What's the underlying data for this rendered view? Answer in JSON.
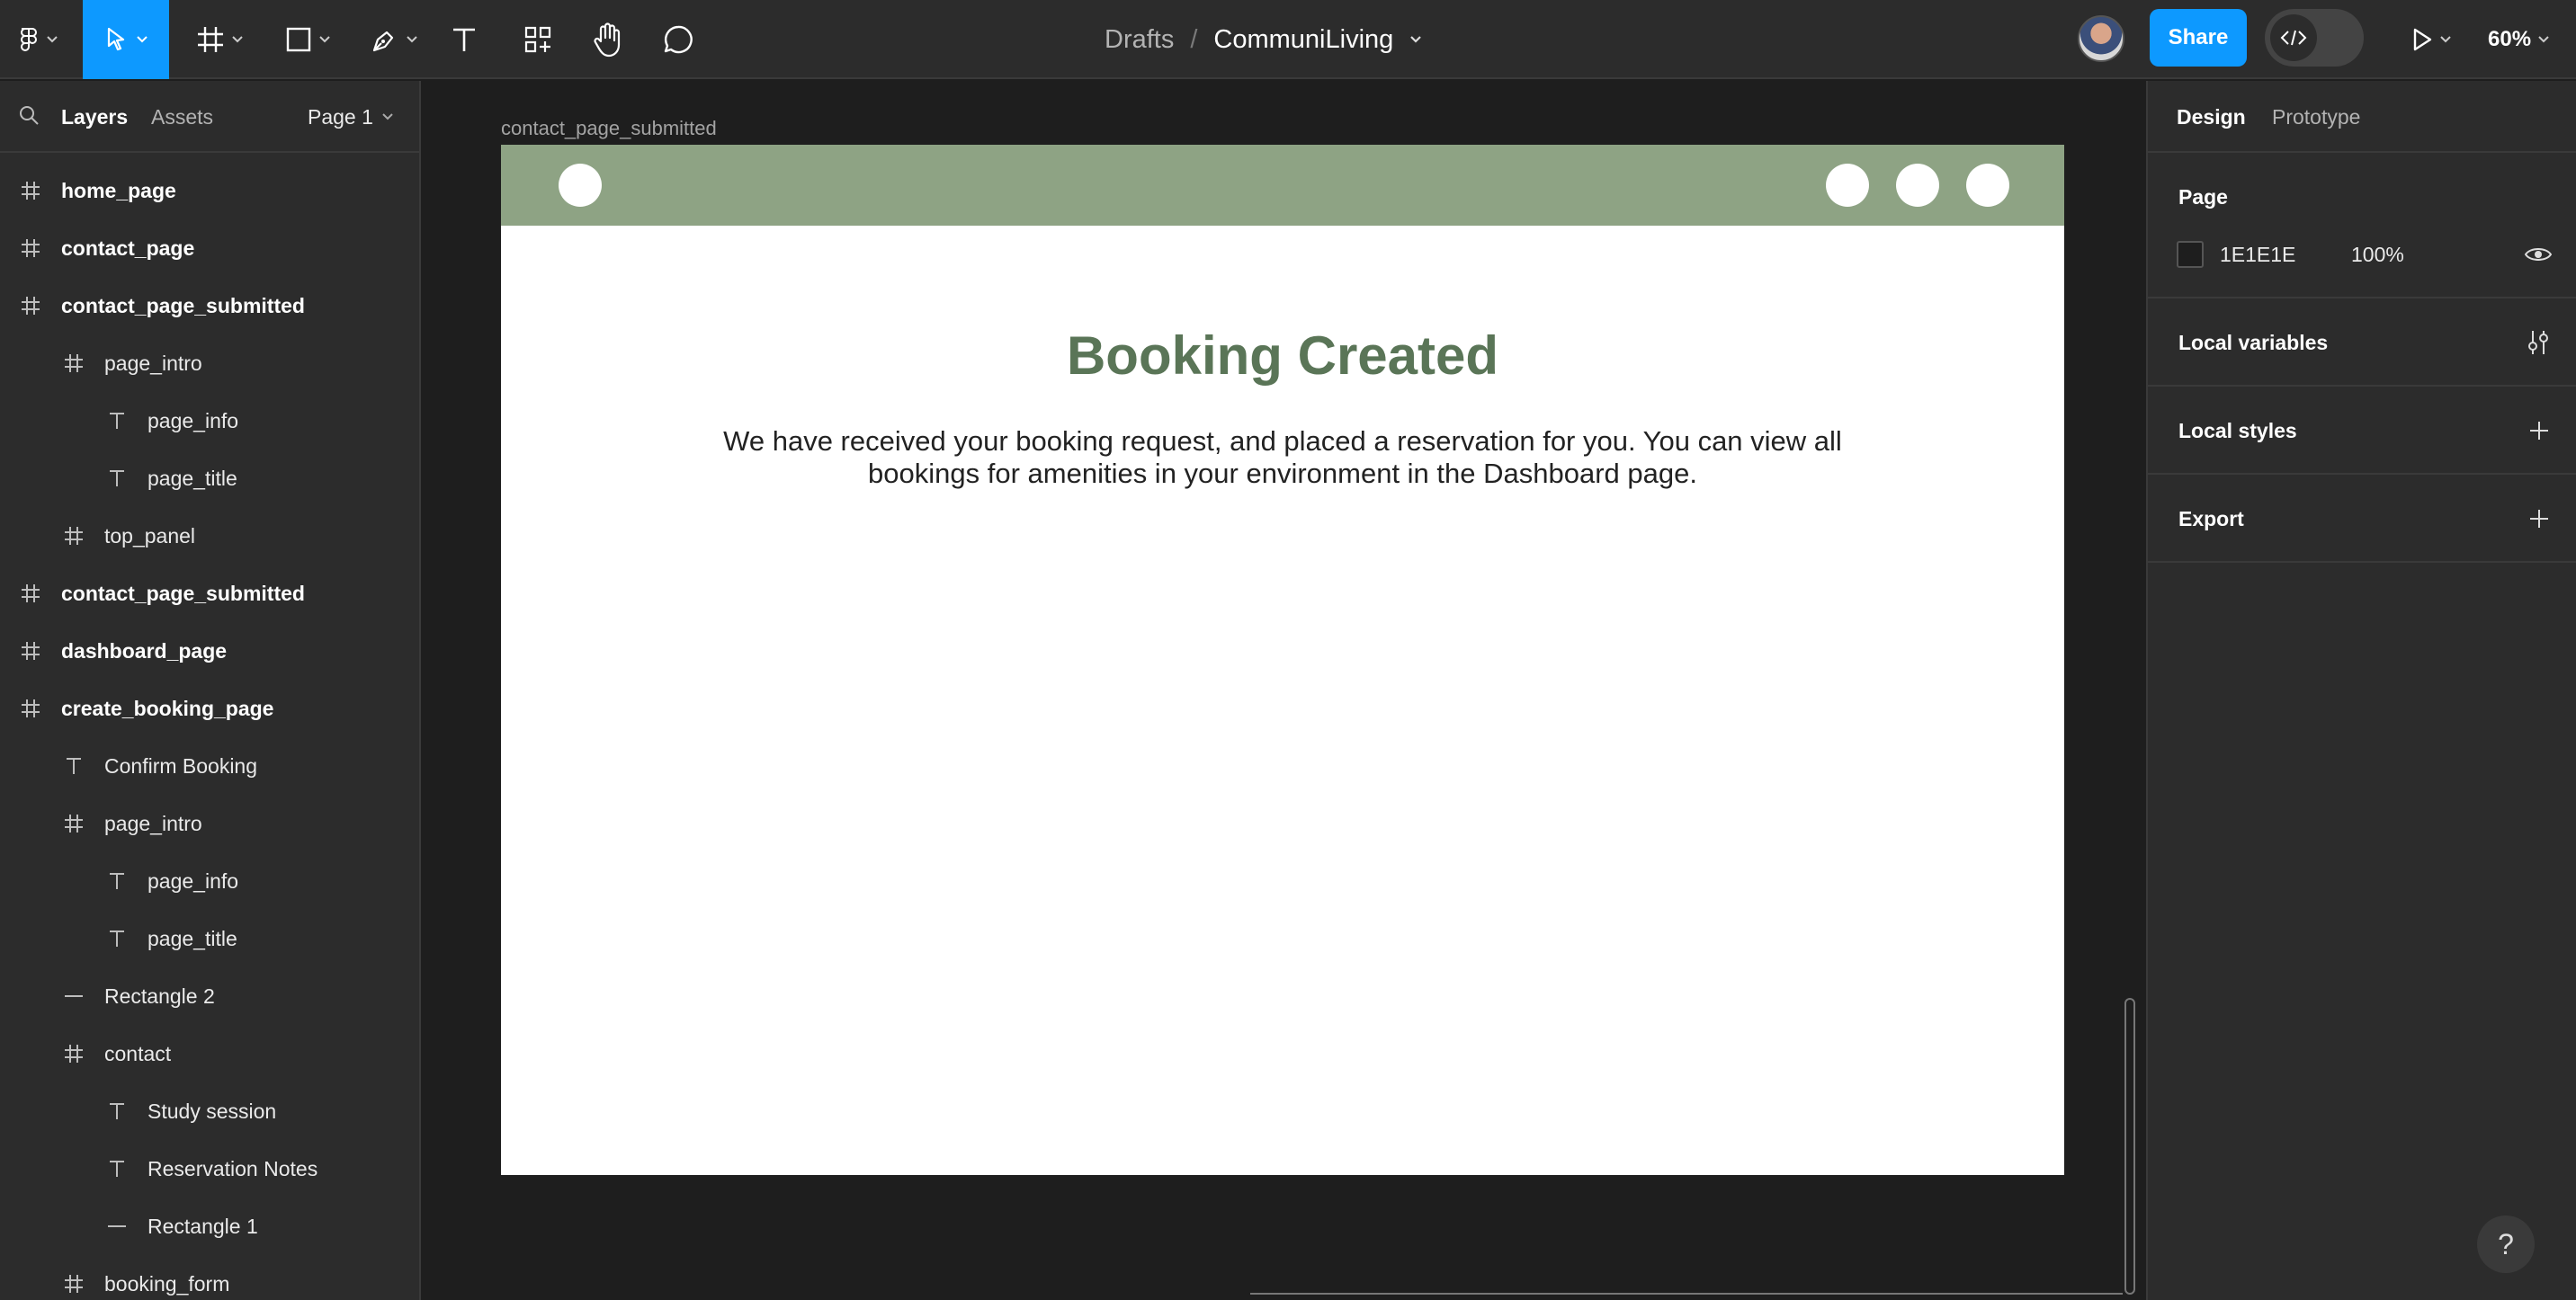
{
  "toolbar": {
    "breadcrumb_root": "Drafts",
    "breadcrumb_sep": "/",
    "file_name": "CommuniLiving",
    "share_label": "Share",
    "zoom": "60%"
  },
  "left_panel": {
    "tab_layers": "Layers",
    "tab_assets": "Assets",
    "page_select": "Page 1",
    "layers": [
      {
        "label": "home_page",
        "type": "frame",
        "depth": 0
      },
      {
        "label": "contact_page",
        "type": "frame",
        "depth": 0
      },
      {
        "label": "contact_page_submitted",
        "type": "frame",
        "depth": 0
      },
      {
        "label": "page_intro",
        "type": "frame",
        "depth": 1
      },
      {
        "label": "page_info",
        "type": "text",
        "depth": 2
      },
      {
        "label": "page_title",
        "type": "text",
        "depth": 2
      },
      {
        "label": "top_panel",
        "type": "frame",
        "depth": 1
      },
      {
        "label": "contact_page_submitted",
        "type": "frame",
        "depth": 0
      },
      {
        "label": "dashboard_page",
        "type": "frame",
        "depth": 0
      },
      {
        "label": "create_booking_page",
        "type": "frame",
        "depth": 0
      },
      {
        "label": "Confirm Booking",
        "type": "text",
        "depth": 1
      },
      {
        "label": "page_intro",
        "type": "frame",
        "depth": 1
      },
      {
        "label": "page_info",
        "type": "text",
        "depth": 2
      },
      {
        "label": "page_title",
        "type": "text",
        "depth": 2
      },
      {
        "label": "Rectangle 2",
        "type": "line",
        "depth": 1
      },
      {
        "label": "contact",
        "type": "frame",
        "depth": 1
      },
      {
        "label": "Study session",
        "type": "text",
        "depth": 2
      },
      {
        "label": "Reservation Notes",
        "type": "text",
        "depth": 2
      },
      {
        "label": "Rectangle 1",
        "type": "line",
        "depth": 2
      },
      {
        "label": "booking_form",
        "type": "frame",
        "depth": 1
      }
    ]
  },
  "canvas": {
    "frame_label": "contact_page_submitted",
    "title": "Booking Created",
    "info": "We have received your booking request, and placed a reservation for you. You can view all bookings for amenities in your environment in the Dashboard page.",
    "topbar_color": "#8EA384",
    "title_color": "#5A7557"
  },
  "right_panel": {
    "tab_design": "Design",
    "tab_prototype": "Prototype",
    "page_heading": "Page",
    "page_color": "1E1E1E",
    "page_opacity": "100%",
    "local_variables": "Local variables",
    "local_styles": "Local styles",
    "export": "Export"
  },
  "help": "?"
}
